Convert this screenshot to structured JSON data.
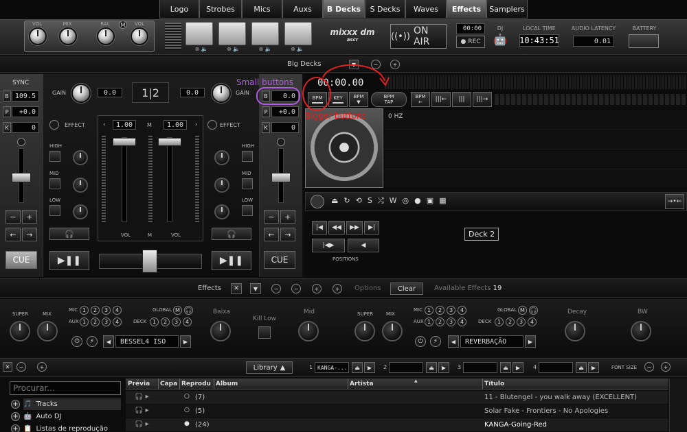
{
  "tabs": [
    "Logo",
    "Strobes",
    "Mics",
    "Auxs",
    "B Decks",
    "S Decks",
    "Waves",
    "Effects",
    "Samplers"
  ],
  "header": {
    "knob_labels": {
      "vol1": "VOL",
      "mix": "MIX",
      "bal": "BAL",
      "m": "M",
      "vol2": "VOL"
    },
    "logo": "mixxx dm",
    "logo_sub": "ascr",
    "on_air": "ON AIR",
    "time_small": "00:00",
    "rec": "REC",
    "dj": "DJ",
    "local_time_label": "LOCAL TIME",
    "local_time": "10:43:51",
    "latency_label": "AUDIO LATENCY",
    "latency": "0.01",
    "battery_label": "BATTERY"
  },
  "bigdecks": {
    "title": "Big Decks"
  },
  "deck_left": {
    "sync": "SYNC",
    "b_label": "B",
    "bpm": "109.5",
    "p_label": "P",
    "pitch": "+0.0",
    "k_label": "K",
    "key": "0",
    "cue": "CUE"
  },
  "deck_right": {
    "b_label": "B",
    "bpm": "0.0",
    "p_label": "P",
    "pitch": "+0.0",
    "k_label": "K",
    "key": "0",
    "cue": "CUE"
  },
  "mixer": {
    "gain": "GAIN",
    "gain_l": "0.0",
    "gain_r": "0.0",
    "deck_sel": "1|2",
    "effect": "EFFECT",
    "high": "HIGH",
    "mid": "MID",
    "low": "LOW",
    "rate_l": "1.00",
    "rate_r": "1.00",
    "m": "M",
    "vol": "VOL"
  },
  "deck2": {
    "time": "00:00.00",
    "hz": "0 HZ",
    "bpm": "BPM",
    "key": "KEY",
    "bpm_tap_1": "BPM",
    "bpm_tap_2": "TAP",
    "label": "Deck 2",
    "positions": "POSITIONS"
  },
  "annotations": {
    "small": "Small buttons",
    "bigger": "Bigger buttons"
  },
  "effects_bar": {
    "title": "Effects",
    "options": "Options",
    "clear": "Clear",
    "available": "Available Effects",
    "count": "19"
  },
  "fx_unit1": {
    "super": "SUPER",
    "mix": "MIX",
    "mic": "MIC",
    "aux": "AUX",
    "global": "GLOBAL",
    "deck": "DECK",
    "m": "M",
    "numbers": [
      "1",
      "2",
      "3",
      "4"
    ],
    "name": "BESSEL4 ISO",
    "p1": "Baixa",
    "p2": "Kill Low",
    "p3": "Mid"
  },
  "fx_unit2": {
    "super": "SUPER",
    "mix": "MIX",
    "mic": "MIC",
    "aux": "AUX",
    "global": "GLOBAL",
    "deck": "DECK",
    "m": "M",
    "numbers": [
      "1",
      "2",
      "3",
      "4"
    ],
    "name": "REVERBAÇÃO",
    "p1": "Decay",
    "p2": "BW"
  },
  "libbar": {
    "library": "Library",
    "t1": "1",
    "track1": "KANGA-...",
    "t2": "2",
    "t3": "3",
    "t4": "4",
    "font_size": "FONT SIZE"
  },
  "search": {
    "placeholder": "Procurar..."
  },
  "sidebar": [
    "Tracks",
    "Auto DJ",
    "Listas de reprodução"
  ],
  "columns": [
    "Prévia",
    "Capa",
    "Reprodu",
    "Album",
    "Artista",
    "Título"
  ],
  "rows": [
    {
      "played": "(7)",
      "title": "11 - Blutengel - you walk away (EXCELLENT)"
    },
    {
      "played": "(5)",
      "title": "Solar Fake - Frontiers - No Apologies"
    },
    {
      "played": "(24)",
      "title": "KANGA-Going-Red"
    }
  ],
  "colors": {
    "annotation_small": "#b05ce0",
    "annotation_big": "#e02020"
  }
}
